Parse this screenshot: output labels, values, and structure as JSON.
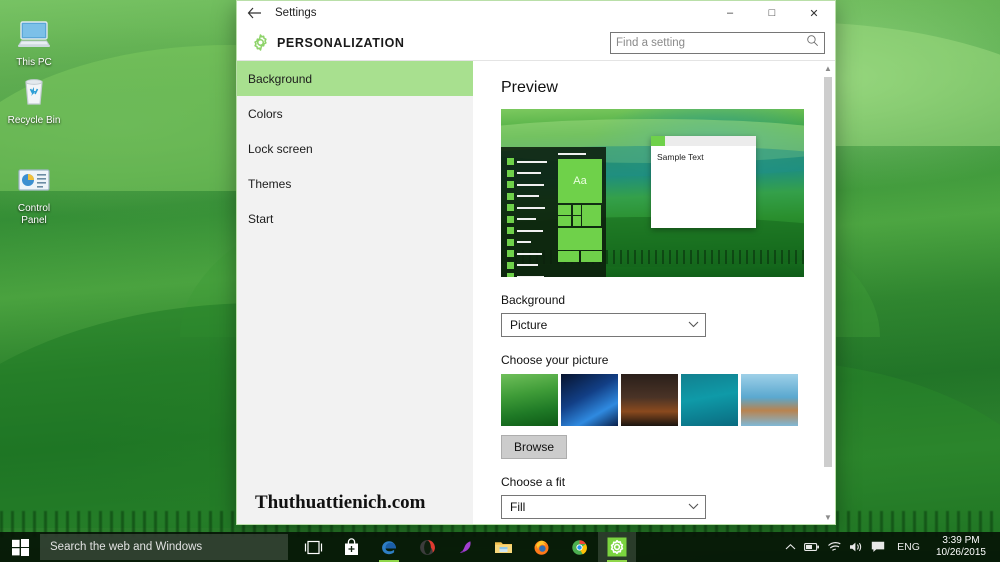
{
  "desktop": {
    "icons": [
      {
        "label": "This PC",
        "icon": "monitor-icon"
      },
      {
        "label": "Recycle Bin",
        "icon": "recycle-bin-icon"
      },
      {
        "label": "Control\nPanel",
        "label_line1": "Control",
        "label_line2": "Panel",
        "icon": "control-panel-icon"
      }
    ],
    "watermark": "Thuthuattienich.com"
  },
  "window": {
    "title": "Settings",
    "back_icon": "back-arrow-icon",
    "minimize": "–",
    "maximize": "□",
    "close": "✕",
    "header": {
      "gear_icon": "gear-icon",
      "page_title": "PERSONALIZATION",
      "search_placeholder": "Find a setting",
      "search_value": "",
      "search_icon": "search-icon"
    }
  },
  "sidebar": {
    "items": [
      {
        "label": "Background",
        "active": true
      },
      {
        "label": "Colors",
        "active": false
      },
      {
        "label": "Lock screen",
        "active": false
      },
      {
        "label": "Themes",
        "active": false
      },
      {
        "label": "Start",
        "active": false
      }
    ]
  },
  "main": {
    "preview_title": "Preview",
    "preview": {
      "tile_letters": "Aa",
      "sample_window_text": "Sample Text"
    },
    "background_label": "Background",
    "background_value": "Picture",
    "choose_picture_label": "Choose your picture",
    "thumbnails": [
      {
        "name": "green-hills-thumbnail",
        "selected": true
      },
      {
        "name": "windows-logo-blue-thumbnail",
        "selected": false
      },
      {
        "name": "night-sky-thumbnail",
        "selected": false
      },
      {
        "name": "underwater-teal-thumbnail",
        "selected": false
      },
      {
        "name": "beach-rock-thumbnail",
        "selected": false
      }
    ],
    "browse_label": "Browse",
    "fit_label": "Choose a fit",
    "fit_value": "Fill",
    "chevron": "⌄"
  },
  "taskbar": {
    "start_icon": "windows-start-icon",
    "search_placeholder": "Search the web and Windows",
    "icons": [
      {
        "name": "task-view-icon"
      },
      {
        "name": "store-icon"
      },
      {
        "name": "edge-icon"
      },
      {
        "name": "opera-icon"
      },
      {
        "name": "purple-app-icon"
      },
      {
        "name": "file-explorer-icon"
      },
      {
        "name": "firefox-icon"
      },
      {
        "name": "chrome-icon"
      },
      {
        "name": "settings-icon"
      }
    ],
    "tray": {
      "chevron_icon": "show-hidden-icons-chevron",
      "battery_icon": "battery-icon",
      "wifi_icon": "wifi-icon",
      "volume_icon": "volume-icon",
      "action_center_icon": "action-center-icon",
      "language": "ENG"
    },
    "clock": {
      "time": "3:39 PM",
      "date": "10/26/2015"
    }
  },
  "colors": {
    "accent_green": "#6fd14a",
    "sidebar_highlight": "#a8e08f",
    "sidebar_bg": "#f2f2f2",
    "window_bg": "#ffffff",
    "taskbar_bg": "#061606"
  }
}
